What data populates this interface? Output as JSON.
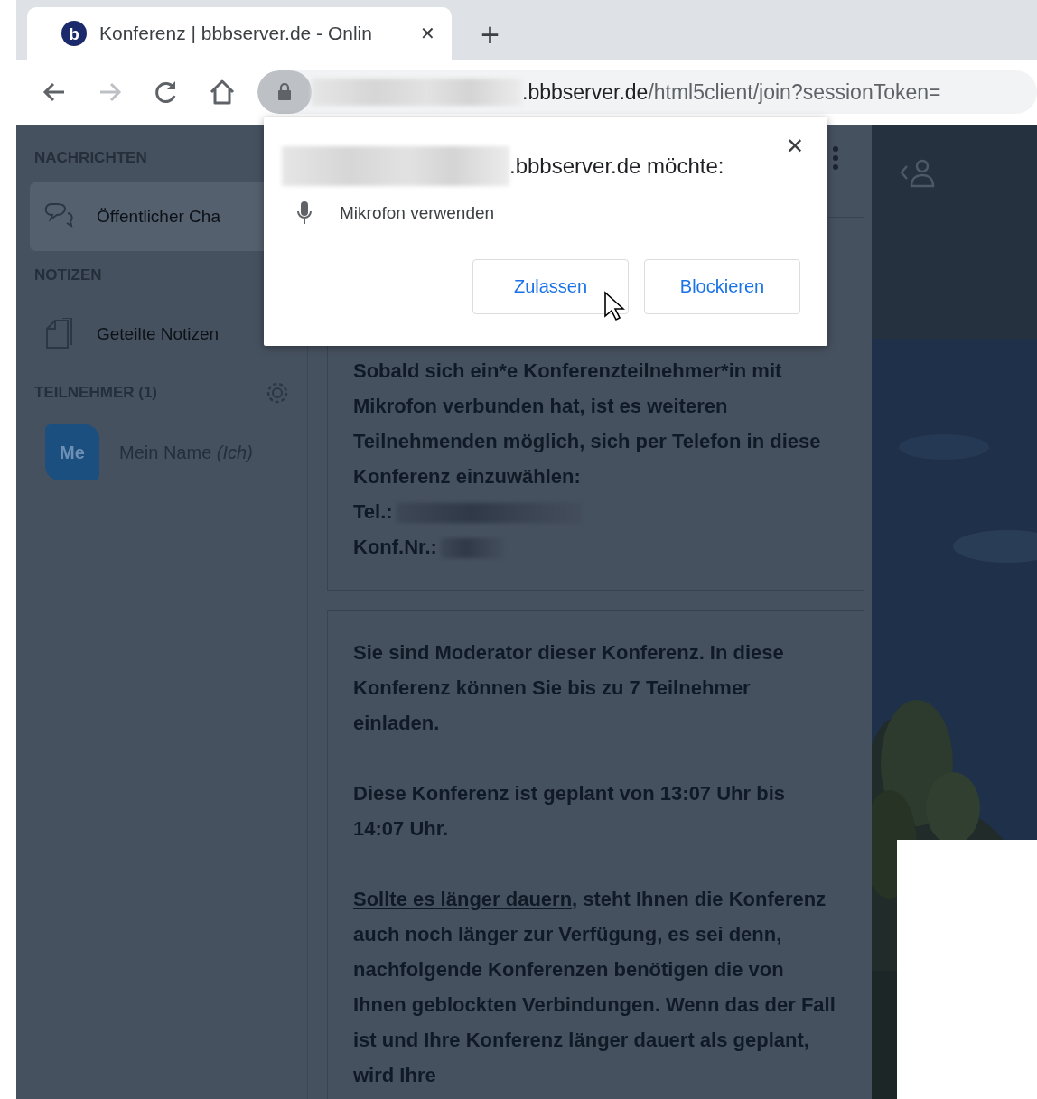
{
  "browser": {
    "tab": {
      "logo_letter": "b",
      "title": "Konferenz | bbbserver.de - Onlin",
      "close": "✕",
      "selected": true
    },
    "new_tab": "+",
    "nav": {
      "back_disabled": false,
      "forward_disabled": true
    },
    "address": {
      "host": ".bbbserver.de",
      "path": "/html5client/join?sessionToken="
    }
  },
  "sidebar": {
    "messages": {
      "heading": "NACHRICHTEN",
      "items": [
        {
          "label": "Öffentlicher Cha",
          "selected": true
        }
      ]
    },
    "notes": {
      "heading": "NOTIZEN",
      "items": [
        {
          "label": "Geteilte Notizen",
          "selected": false
        }
      ]
    },
    "participants": {
      "heading": "TEILNEHMER (1)",
      "users": [
        {
          "avatar": "Me",
          "name": "Mein Name *(Ich)*"
        }
      ]
    }
  },
  "chat": {
    "messages": [
      {
        "intro": "Sobald sich ein*e Konferenzteilnehmer*in mit Mikrofon verbunden hat, ist es weiteren Teilnehmenden möglich, sich per Telefon in diese Konferenz einzuwählen:",
        "dial_in": [
          {
            "label": "Tel.:"
          },
          {
            "label": "Konf.Nr.:"
          }
        ]
      },
      {
        "paragraphs": [
          {
            "text": "Sie sind Moderator dieser Konferenz. In diese Konferenz können Sie bis zu 7 Teilnehmer einladen."
          },
          {
            "text": "Diese Konferenz ist geplant von 13:07 Uhr bis 14:07 Uhr."
          },
          {
            "link": "Sollte es länger dauern",
            "text": ", steht Ihnen die Konferenz auch noch länger zur Verfügung, es sei denn, nachfolgende Konferenzen benötigen die von Ihnen geblockten Verbindungen. Wenn das der Fall ist und Ihre Konferenz länger dauert als geplant, wird Ihre"
          }
        ]
      }
    ]
  },
  "permission_popup": {
    "origin_suffix": ".bbbserver.de möchte:",
    "close": "✕",
    "permission": "Mikrofon verwenden",
    "buttons": [
      {
        "label": "Zulassen"
      },
      {
        "label": "Blockieren"
      }
    ]
  }
}
